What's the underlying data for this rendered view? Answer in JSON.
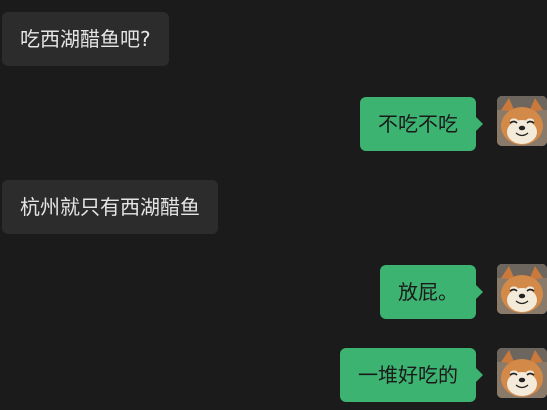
{
  "colors": {
    "background": "#1b1b1b",
    "incoming_bubble": "#2c2c2c",
    "outgoing_bubble": "#3cb371"
  },
  "messages": [
    {
      "side": "in",
      "text": "吃西湖醋鱼吧?"
    },
    {
      "side": "out",
      "text": "不吃不吃",
      "avatar": "shiba-dog-avatar"
    },
    {
      "side": "in",
      "text": "杭州就只有西湖醋鱼"
    },
    {
      "side": "out",
      "text": "放屁。",
      "avatar": "shiba-dog-avatar"
    },
    {
      "side": "out",
      "text": "一堆好吃的",
      "avatar": "shiba-dog-avatar"
    }
  ]
}
